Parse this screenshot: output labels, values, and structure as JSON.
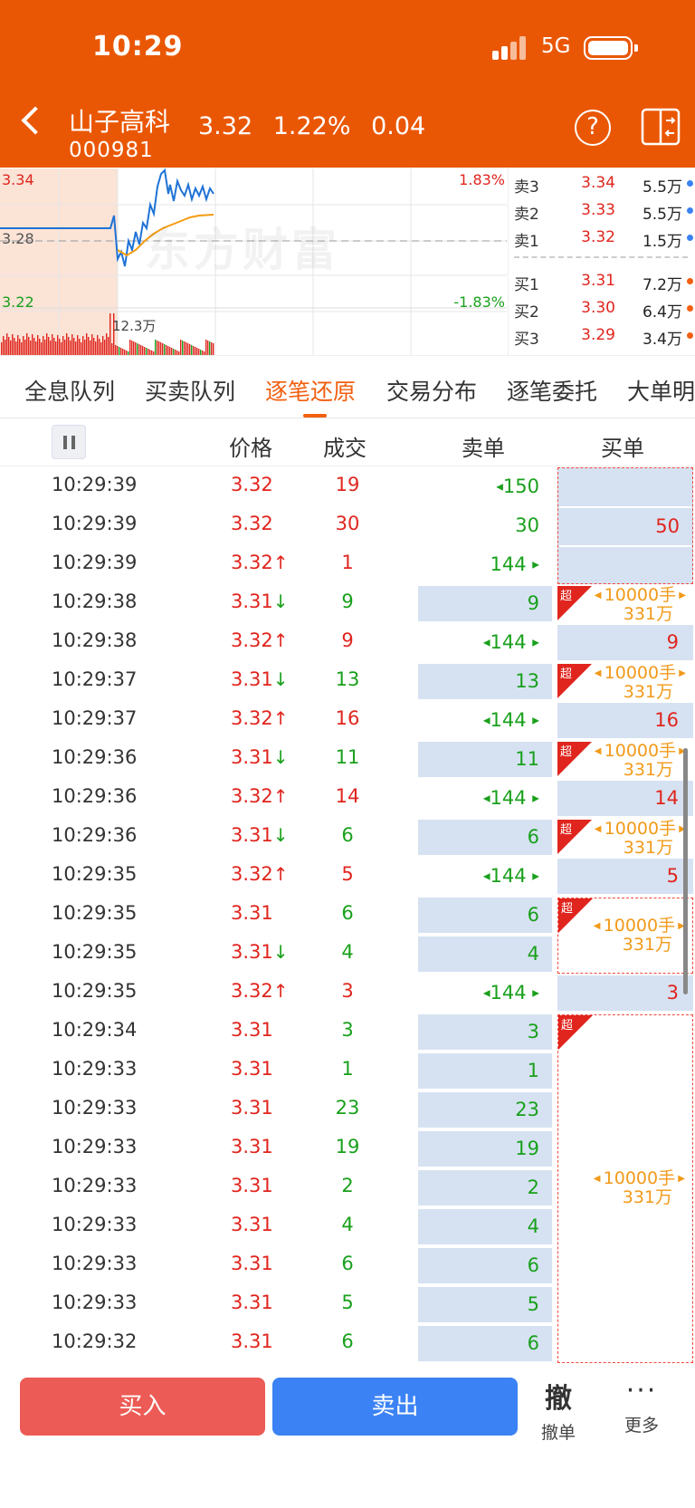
{
  "status_bar": {
    "time": "10:29",
    "network": "5G"
  },
  "stock": {
    "name": "山子高科",
    "code": "000981",
    "price": "3.32",
    "change_pct": "1.22%",
    "change": "0.04"
  },
  "header": {
    "help_glyph": "?"
  },
  "mini_chart": {
    "high_label": "3.34",
    "base_label": "3.28",
    "low_label": "3.22",
    "up_pct": "1.83%",
    "down_pct": "-1.83%",
    "volume_label": "12.3万",
    "watermark": "东方财富"
  },
  "order_book": {
    "asks": [
      {
        "label": "卖3",
        "price": "3.34",
        "volume": "5.5万"
      },
      {
        "label": "卖2",
        "price": "3.33",
        "volume": "5.5万"
      },
      {
        "label": "卖1",
        "price": "3.32",
        "volume": "1.5万"
      }
    ],
    "bids": [
      {
        "label": "买1",
        "price": "3.31",
        "volume": "7.2万"
      },
      {
        "label": "买2",
        "price": "3.30",
        "volume": "6.4万"
      },
      {
        "label": "买3",
        "price": "3.29",
        "volume": "3.4万"
      }
    ]
  },
  "tabs": [
    "全息队列",
    "买卖队列",
    "逐笔还原",
    "交易分布",
    "逐笔委托",
    "大单明细"
  ],
  "active_tab": "逐笔还原",
  "columns": {
    "price": "价格",
    "volume": "成交",
    "sell": "卖单",
    "buy": "买单"
  },
  "trades": [
    {
      "time": "10:29:39",
      "price": "3.32",
      "dir": "",
      "vol": "19",
      "vol_color": "red",
      "sell": "150",
      "sell_arrows": "left",
      "sell_bg": false
    },
    {
      "time": "10:29:39",
      "price": "3.32",
      "dir": "",
      "vol": "30",
      "vol_color": "red",
      "sell": "30",
      "sell_arrows": "",
      "sell_bg": false
    },
    {
      "time": "10:29:39",
      "price": "3.32",
      "dir": "up",
      "vol": "1",
      "vol_color": "red",
      "sell": "144",
      "sell_arrows": "right",
      "sell_bg": false
    },
    {
      "time": "10:29:38",
      "price": "3.31",
      "dir": "down",
      "vol": "9",
      "vol_color": "green",
      "sell": "9",
      "sell_arrows": "",
      "sell_bg": true
    },
    {
      "time": "10:29:38",
      "price": "3.32",
      "dir": "up",
      "vol": "9",
      "vol_color": "red",
      "sell": "144",
      "sell_arrows": "both",
      "sell_bg": false,
      "buy": "9"
    },
    {
      "time": "10:29:37",
      "price": "3.31",
      "dir": "down",
      "vol": "13",
      "vol_color": "green",
      "sell": "13",
      "sell_arrows": "",
      "sell_bg": true
    },
    {
      "time": "10:29:37",
      "price": "3.32",
      "dir": "up",
      "vol": "16",
      "vol_color": "red",
      "sell": "144",
      "sell_arrows": "both",
      "sell_bg": false,
      "buy": "16"
    },
    {
      "time": "10:29:36",
      "price": "3.31",
      "dir": "down",
      "vol": "11",
      "vol_color": "green",
      "sell": "11",
      "sell_arrows": "",
      "sell_bg": true
    },
    {
      "time": "10:29:36",
      "price": "3.32",
      "dir": "up",
      "vol": "14",
      "vol_color": "red",
      "sell": "144",
      "sell_arrows": "both",
      "sell_bg": false,
      "buy": "14"
    },
    {
      "time": "10:29:36",
      "price": "3.31",
      "dir": "down",
      "vol": "6",
      "vol_color": "green",
      "sell": "6",
      "sell_arrows": "",
      "sell_bg": true
    },
    {
      "time": "10:29:35",
      "price": "3.32",
      "dir": "up",
      "vol": "5",
      "vol_color": "red",
      "sell": "144",
      "sell_arrows": "both",
      "sell_bg": false,
      "buy": "5"
    },
    {
      "time": "10:29:35",
      "price": "3.31",
      "dir": "",
      "vol": "6",
      "vol_color": "green",
      "sell": "6",
      "sell_arrows": "",
      "sell_bg": true
    },
    {
      "time": "10:29:35",
      "price": "3.31",
      "dir": "down",
      "vol": "4",
      "vol_color": "green",
      "sell": "4",
      "sell_arrows": "",
      "sell_bg": true
    },
    {
      "time": "10:29:35",
      "price": "3.32",
      "dir": "up",
      "vol": "3",
      "vol_color": "red",
      "sell": "144",
      "sell_arrows": "both",
      "sell_bg": false,
      "buy": "3"
    },
    {
      "time": "10:29:34",
      "price": "3.31",
      "dir": "",
      "vol": "3",
      "vol_color": "green",
      "sell": "3",
      "sell_arrows": "",
      "sell_bg": true
    },
    {
      "time": "10:29:33",
      "price": "3.31",
      "dir": "",
      "vol": "1",
      "vol_color": "green",
      "sell": "1",
      "sell_arrows": "",
      "sell_bg": true
    },
    {
      "time": "10:29:33",
      "price": "3.31",
      "dir": "",
      "vol": "23",
      "vol_color": "green",
      "sell": "23",
      "sell_arrows": "",
      "sell_bg": true
    },
    {
      "time": "10:29:33",
      "price": "3.31",
      "dir": "",
      "vol": "19",
      "vol_color": "green",
      "sell": "19",
      "sell_arrows": "",
      "sell_bg": true
    },
    {
      "time": "10:29:33",
      "price": "3.31",
      "dir": "",
      "vol": "2",
      "vol_color": "green",
      "sell": "2",
      "sell_arrows": "",
      "sell_bg": true
    },
    {
      "time": "10:29:33",
      "price": "3.31",
      "dir": "",
      "vol": "4",
      "vol_color": "green",
      "sell": "4",
      "sell_arrows": "",
      "sell_bg": true
    },
    {
      "time": "10:29:33",
      "price": "3.31",
      "dir": "",
      "vol": "6",
      "vol_color": "green",
      "sell": "6",
      "sell_arrows": "",
      "sell_bg": true
    },
    {
      "time": "10:29:33",
      "price": "3.31",
      "dir": "",
      "vol": "5",
      "vol_color": "green",
      "sell": "5",
      "sell_arrows": "",
      "sell_bg": true
    },
    {
      "time": "10:29:32",
      "price": "3.31",
      "dir": "",
      "vol": "6",
      "vol_color": "green",
      "sell": "6",
      "sell_arrows": "",
      "sell_bg": true
    }
  ],
  "buy_group_top": {
    "value": "50"
  },
  "big_orders": [
    {
      "badge": "超",
      "hands": "10000手",
      "amount": "331万"
    },
    {
      "badge": "超",
      "hands": "10000手",
      "amount": "331万"
    },
    {
      "badge": "超",
      "hands": "10000手",
      "amount": "331万"
    },
    {
      "badge": "超",
      "hands": "10000手",
      "amount": "331万"
    },
    {
      "badge": "超",
      "hands": "10000手",
      "amount": "331万"
    },
    {
      "badge": "超",
      "hands": "10000手",
      "amount": "331万"
    }
  ],
  "bottom": {
    "buy": "买入",
    "sell": "卖出",
    "cancel_icon": "撤",
    "cancel": "撤单",
    "more_icon": "···",
    "more": "更多"
  },
  "colors": {
    "header": "#ea5704",
    "accent": "#f25f10",
    "up": "#e0251e",
    "down": "#19a01c",
    "buy_btn": "#ec5b55",
    "sell_btn": "#3b82f4",
    "big_order": "#f29a1a"
  }
}
